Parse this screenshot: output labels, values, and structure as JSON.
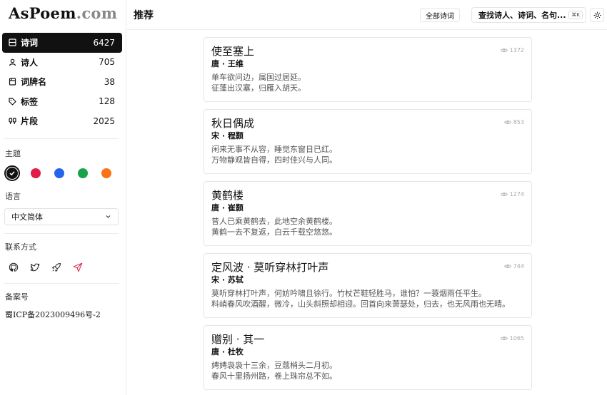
{
  "logo": {
    "main": "AsPoem",
    "suffix": ".com"
  },
  "nav": [
    {
      "icon": "poem-list-icon",
      "label": "诗词",
      "count": "6427",
      "active": true
    },
    {
      "icon": "user-icon",
      "label": "诗人",
      "count": "705",
      "active": false
    },
    {
      "icon": "book-icon",
      "label": "词牌名",
      "count": "38",
      "active": false
    },
    {
      "icon": "tag-icon",
      "label": "标签",
      "count": "128",
      "active": false
    },
    {
      "icon": "quote-icon",
      "label": "片段",
      "count": "2025",
      "active": false
    }
  ],
  "theme": {
    "title": "主题",
    "colors": [
      "#111111",
      "#e11d48",
      "#2563eb",
      "#16a34a",
      "#f97316"
    ],
    "selected": 0
  },
  "language": {
    "title": "语言",
    "value": "中文简体"
  },
  "contact": {
    "title": "联系方式",
    "icons": [
      "github-icon",
      "twitter-icon",
      "rocket-icon",
      "send-icon"
    ]
  },
  "icp": {
    "title": "备案号",
    "value": "蜀ICP备2023009496号-2"
  },
  "header": {
    "title": "推荐",
    "all_button": "全部诗词",
    "search_placeholder": "查找诗人、诗词、名句...",
    "shortcut": "⌘K"
  },
  "poems": [
    {
      "title": "使至塞上",
      "meta": "唐 · 王维",
      "lines": [
        "单车欲问边，属国过居延。",
        "征蓬出汉塞，归雁入胡天。"
      ],
      "views": "1372"
    },
    {
      "title": "秋日偶成",
      "meta": "宋 · 程颢",
      "lines": [
        "闲来无事不从容，睡觉东窗日已红。",
        "万物静观皆自得，四时佳兴与人同。"
      ],
      "views": "853"
    },
    {
      "title": "黄鹤楼",
      "meta": "唐 · 崔颢",
      "lines": [
        "昔人已乘黄鹤去，此地空余黄鹤楼。",
        "黄鹤一去不复返，白云千载空悠悠。"
      ],
      "views": "1274"
    },
    {
      "title": "定风波 · 莫听穿林打叶声",
      "meta": "宋 · 苏轼",
      "lines": [
        "莫听穿林打叶声，何妨吟啸且徐行。竹杖芒鞋轻胜马，谁怕？一蓑烟雨任平生。",
        "料峭春风吹酒醒，微冷，山头斜照却相迎。回首向来萧瑟处，归去，也无风雨也无晴。"
      ],
      "views": "744"
    },
    {
      "title": "赠别 · 其一",
      "meta": "唐 · 杜牧",
      "lines": [
        "娉娉袅袅十三余，豆蔻梢头二月初。",
        "春风十里扬州路，卷上珠帘总不如。"
      ],
      "views": "1065"
    }
  ]
}
